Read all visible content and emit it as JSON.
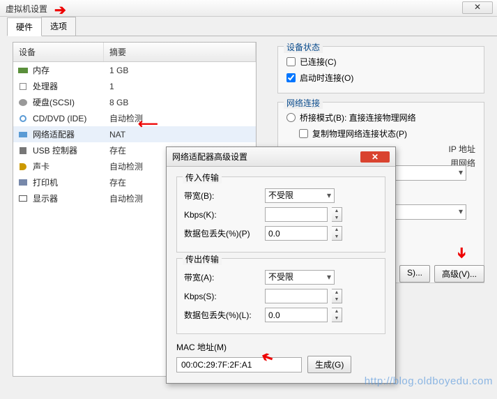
{
  "window": {
    "title": "虚拟机设置"
  },
  "tabs": {
    "hw": "硬件",
    "opt": "选项"
  },
  "headers": {
    "device": "设备",
    "summary": "摘要"
  },
  "devices": [
    {
      "name": "内存",
      "summary": "1 GB",
      "icon": "ic-mem"
    },
    {
      "name": "处理器",
      "summary": "1",
      "icon": "ic-cpu"
    },
    {
      "name": "硬盘(SCSI)",
      "summary": "8 GB",
      "icon": "ic-hdd"
    },
    {
      "name": "CD/DVD (IDE)",
      "summary": "自动检测",
      "icon": "ic-cd"
    },
    {
      "name": "网络适配器",
      "summary": "NAT",
      "icon": "ic-net",
      "selected": true
    },
    {
      "name": "USB 控制器",
      "summary": "存在",
      "icon": "ic-usb"
    },
    {
      "name": "声卡",
      "summary": "自动检测",
      "icon": "ic-snd"
    },
    {
      "name": "打印机",
      "summary": "存在",
      "icon": "ic-prn"
    },
    {
      "name": "显示器",
      "summary": "自动检测",
      "icon": "ic-dsp"
    }
  ],
  "status": {
    "title": "设备状态",
    "connected": "已连接(C)",
    "poweron": "启动时连接(O)"
  },
  "netconn": {
    "title": "网络连接",
    "bridge": "桥接模式(B): 直接连接物理网络",
    "replicate": "复制物理网络连接状态(P)",
    "ip_tail": "IP 地址",
    "usenet_tail": "用网络"
  },
  "buttons": {
    "segs": "S)...",
    "advanced": "高级(V)..."
  },
  "modal": {
    "title": "网络适配器高级设置",
    "in": {
      "title": "传入传输",
      "bw": "带宽(B):",
      "bw_val": "不受限",
      "kbps": "Kbps(K):",
      "loss": "数据包丢失(%)(P)",
      "loss_val": "0.0"
    },
    "out": {
      "title": "传出传输",
      "bw": "带宽(A):",
      "bw_val": "不受限",
      "kbps": "Kbps(S):",
      "loss": "数据包丢失(%)(L):",
      "loss_val": "0.0"
    },
    "mac": {
      "label": "MAC 地址(M)",
      "value": "00:0C:29:7F:2F:A1",
      "gen": "生成(G)"
    }
  },
  "watermark": "http://blog.oldboyedu.com"
}
